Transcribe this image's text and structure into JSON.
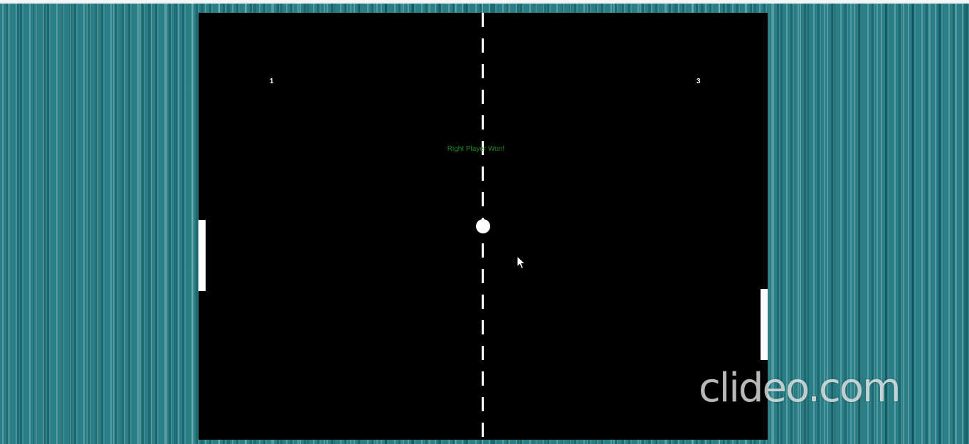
{
  "game": {
    "score_left": "1",
    "score_right": "3",
    "message": "Right Player Won!"
  },
  "watermark": {
    "text": "clideo.com"
  },
  "colors": {
    "court": "#000000",
    "paddle": "#ffffff",
    "ball": "#ffffff",
    "net": "#ffffff",
    "message": "#1f8a1f",
    "background": "#2a7f86"
  },
  "icons": {
    "cursor": "mouse-pointer-icon"
  }
}
